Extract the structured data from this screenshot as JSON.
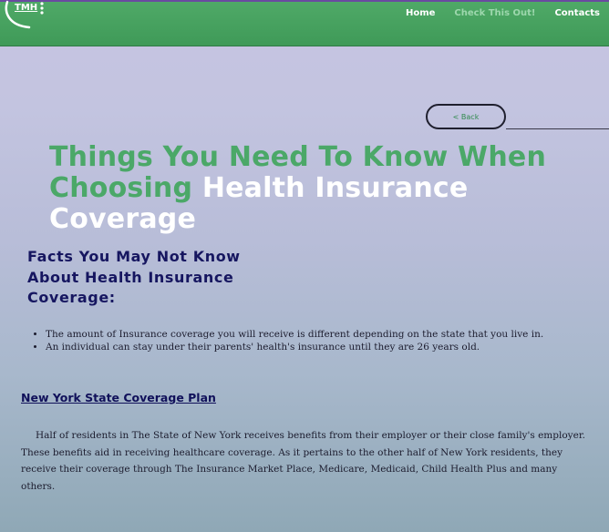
{
  "header": {
    "logo_text": "TMH",
    "nav": [
      {
        "label": "Home"
      },
      {
        "label": "Check This Out!"
      },
      {
        "label": "Contacts"
      }
    ],
    "active_index": 1
  },
  "back_button": {
    "label": "< Back"
  },
  "title": {
    "line1": "Things You Need To Know When",
    "line2_green": "Choosing",
    "line2_white": "Health Insurance Coverage"
  },
  "subtitle": "Facts You May Not Know About Health Insurance Coverage:",
  "facts": [
    "The amount of Insurance coverage you will receive is different depending on the state that you live in.",
    "An individual can stay under their parents' health's insurance until they are 26 years old."
  ],
  "section": {
    "heading": "New York State Coverage Plan",
    "paragraph": "Half of residents in The State of New York receives benefits from their employer or their close family's employer. These benefits aid in receiving healthcare coverage. As it pertains to the other half of New York residents, they receive their coverage through The Insurance Market Place, Medicare, Medicaid, Child Health Plus and many others."
  },
  "colors": {
    "nav_green": "#4fa967",
    "title_green": "#4ba868",
    "heading_navy": "#161660"
  }
}
